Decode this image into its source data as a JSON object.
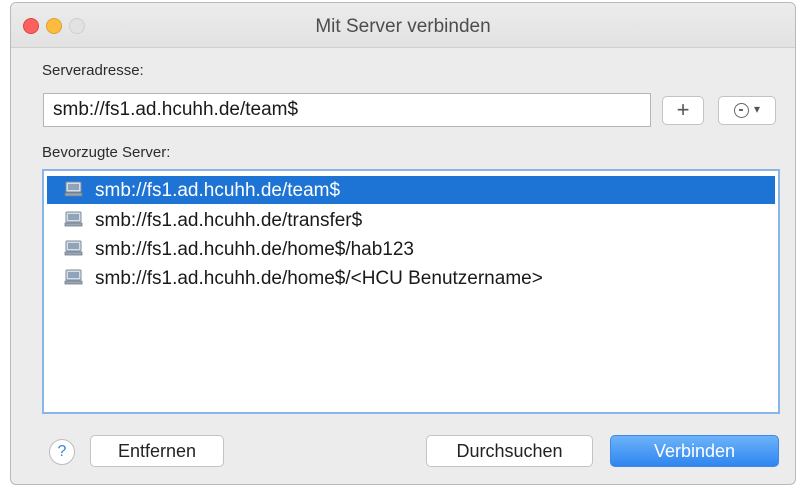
{
  "window": {
    "title": "Mit Server verbinden"
  },
  "form": {
    "address_label": "Serveradresse:",
    "address_value": "smb://fs1.ad.hcuhh.de/team$",
    "add_button_label": "+",
    "favorites_label": "Bevorzugte Server:"
  },
  "favorites": [
    {
      "label": "smb://fs1.ad.hcuhh.de/team$",
      "selected": true,
      "icon": "server-icon"
    },
    {
      "label": "smb://fs1.ad.hcuhh.de/transfer$",
      "selected": false,
      "icon": "server-icon"
    },
    {
      "label": "smb://fs1.ad.hcuhh.de/home$/hab123",
      "selected": false,
      "icon": "server-icon"
    },
    {
      "label": "smb://fs1.ad.hcuhh.de/home$/<HCU Benutzername>",
      "selected": false,
      "icon": "server-icon"
    }
  ],
  "buttons": {
    "help": "?",
    "remove": "Entfernen",
    "browse": "Durchsuchen",
    "connect": "Verbinden"
  },
  "colors": {
    "selection": "#1e74d4",
    "primary_button": "#2f86f0",
    "close": "#fc615d",
    "minimize": "#fdbc40"
  }
}
